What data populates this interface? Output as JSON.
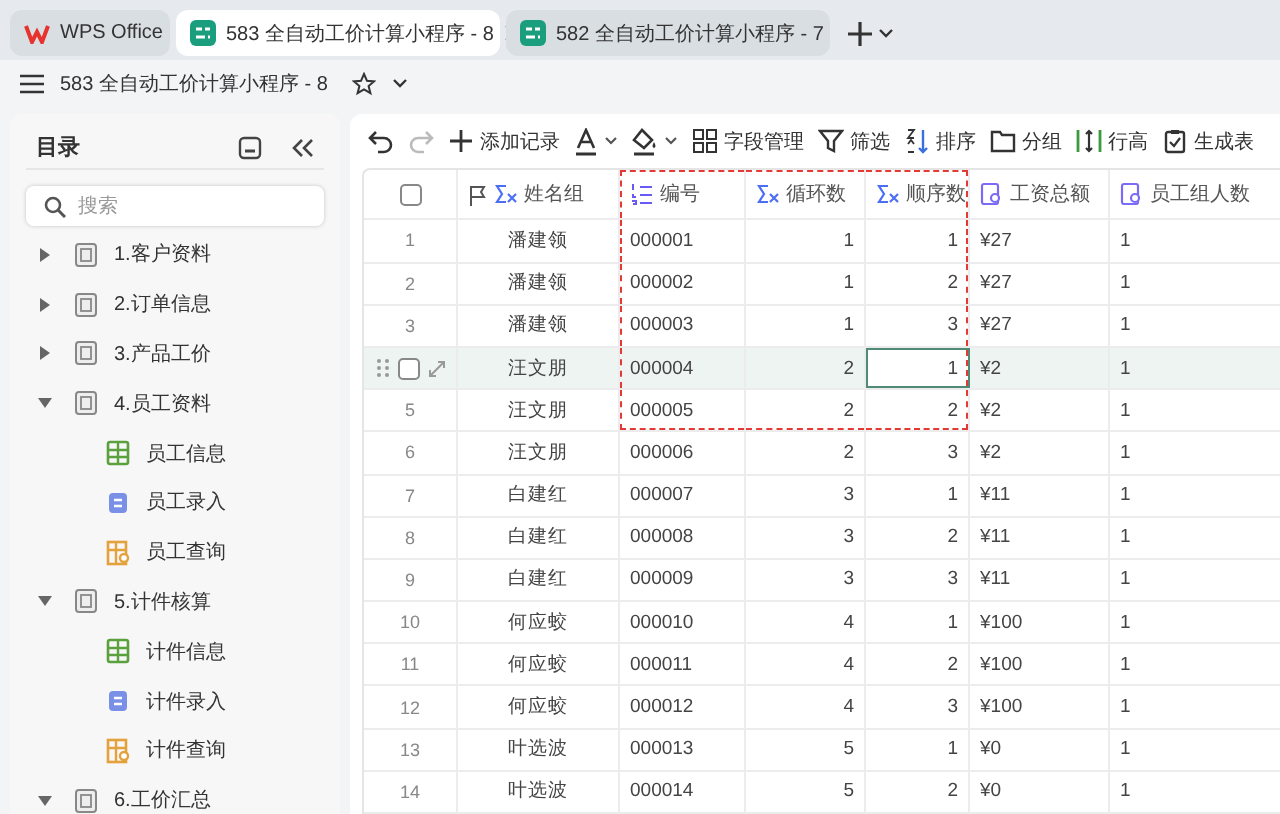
{
  "tabs": [
    {
      "kind": "home",
      "label": "WPS Office",
      "selected": false
    },
    {
      "kind": "doc",
      "label": "583 全自动工价计算小程序 - 8",
      "selected": true
    },
    {
      "kind": "doc",
      "label": "582 全自动工价计算小程序 - 7",
      "selected": false
    }
  ],
  "document": {
    "title": "583 全自动工价计算小程序 - 8"
  },
  "sidebar": {
    "title": "目录",
    "search": {
      "placeholder": "搜索"
    },
    "items": [
      {
        "kind": "folder",
        "label": "1.客户资料",
        "expanded": false
      },
      {
        "kind": "folder",
        "label": "2.订单信息",
        "expanded": false
      },
      {
        "kind": "folder",
        "label": "3.产品工价",
        "expanded": false
      },
      {
        "kind": "folder",
        "label": "4.员工资料",
        "expanded": true,
        "children": [
          {
            "kind": "table",
            "label": "员工信息"
          },
          {
            "kind": "form",
            "label": "员工录入"
          },
          {
            "kind": "query",
            "label": "员工查询"
          }
        ]
      },
      {
        "kind": "folder",
        "label": "5.计件核算",
        "expanded": true,
        "children": [
          {
            "kind": "table",
            "label": "计件信息"
          },
          {
            "kind": "form",
            "label": "计件录入"
          },
          {
            "kind": "query",
            "label": "计件查询"
          }
        ]
      },
      {
        "kind": "folder",
        "label": "6.工价汇总",
        "expanded": true
      }
    ]
  },
  "toolbar": [
    {
      "kind": "undo",
      "disabled": false
    },
    {
      "kind": "redo",
      "disabled": true
    },
    {
      "kind": "add",
      "label": "添加记录"
    },
    {
      "kind": "font-color"
    },
    {
      "kind": "fill-color"
    },
    {
      "kind": "fields",
      "label": "字段管理"
    },
    {
      "kind": "filter",
      "label": "筛选"
    },
    {
      "kind": "sort",
      "label": "排序"
    },
    {
      "kind": "group",
      "label": "分组"
    },
    {
      "kind": "row-height",
      "label": "行高"
    },
    {
      "kind": "generate",
      "label": "生成表"
    }
  ],
  "table": {
    "select_all_checked": false,
    "columns": [
      {
        "kind": "formula",
        "label": "姓名组",
        "primary": true,
        "framed": false,
        "focused": false
      },
      {
        "kind": "autonumber",
        "label": "编号",
        "primary": false,
        "framed": true,
        "focused": false
      },
      {
        "kind": "formula",
        "label": "循环数",
        "primary": false,
        "framed": true,
        "focused": false
      },
      {
        "kind": "formula",
        "label": "顺序数",
        "primary": false,
        "framed": true,
        "focused": true
      },
      {
        "kind": "lookup",
        "label": "工资总额",
        "primary": false,
        "framed": false,
        "focused": false
      },
      {
        "kind": "lookup",
        "label": "员工组人数",
        "primary": false,
        "framed": false,
        "focused": false
      }
    ],
    "rows": [
      {
        "number": "1",
        "selected": false,
        "checked": false,
        "framed": true,
        "focused": false,
        "cells": [
          "潘建领",
          "000001",
          "1",
          "1",
          "¥27",
          "1"
        ]
      },
      {
        "number": "2",
        "selected": false,
        "checked": false,
        "framed": true,
        "focused": false,
        "cells": [
          "潘建领",
          "000002",
          "1",
          "2",
          "¥27",
          "1"
        ]
      },
      {
        "number": "3",
        "selected": false,
        "checked": false,
        "framed": true,
        "focused": false,
        "cells": [
          "潘建领",
          "000003",
          "1",
          "3",
          "¥27",
          "1"
        ]
      },
      {
        "selected": true,
        "checked": false,
        "framed": true,
        "focused": true,
        "cells": [
          "汪文朋",
          "000004",
          "2",
          "1",
          "¥2",
          "1"
        ]
      },
      {
        "number": "5",
        "selected": false,
        "checked": false,
        "framed": true,
        "focused": false,
        "cells": [
          "汪文朋",
          "000005",
          "2",
          "2",
          "¥2",
          "1"
        ]
      },
      {
        "number": "6",
        "selected": false,
        "checked": false,
        "framed": false,
        "focused": false,
        "cells": [
          "汪文朋",
          "000006",
          "2",
          "3",
          "¥2",
          "1"
        ]
      },
      {
        "number": "7",
        "selected": false,
        "checked": false,
        "framed": false,
        "focused": false,
        "cells": [
          "白建红",
          "000007",
          "3",
          "1",
          "¥11",
          "1"
        ]
      },
      {
        "number": "8",
        "selected": false,
        "checked": false,
        "framed": false,
        "focused": false,
        "cells": [
          "白建红",
          "000008",
          "3",
          "2",
          "¥11",
          "1"
        ]
      },
      {
        "number": "9",
        "selected": false,
        "checked": false,
        "framed": false,
        "focused": false,
        "cells": [
          "白建红",
          "000009",
          "3",
          "3",
          "¥11",
          "1"
        ]
      },
      {
        "number": "10",
        "selected": false,
        "checked": false,
        "framed": false,
        "focused": false,
        "cells": [
          "何应蛟",
          "000010",
          "4",
          "1",
          "¥100",
          "1"
        ]
      },
      {
        "number": "11",
        "selected": false,
        "checked": false,
        "framed": false,
        "focused": false,
        "cells": [
          "何应蛟",
          "000011",
          "4",
          "2",
          "¥100",
          "1"
        ]
      },
      {
        "number": "12",
        "selected": false,
        "checked": false,
        "framed": false,
        "focused": false,
        "cells": [
          "何应蛟",
          "000012",
          "4",
          "3",
          "¥100",
          "1"
        ]
      },
      {
        "number": "13",
        "selected": false,
        "checked": false,
        "framed": false,
        "focused": false,
        "cells": [
          "叶选波",
          "000013",
          "5",
          "1",
          "¥0",
          "1"
        ]
      },
      {
        "number": "14",
        "selected": false,
        "checked": false,
        "framed": false,
        "focused": false,
        "cells": [
          "叶选波",
          "000014",
          "5",
          "2",
          "¥0",
          "1"
        ]
      }
    ]
  }
}
